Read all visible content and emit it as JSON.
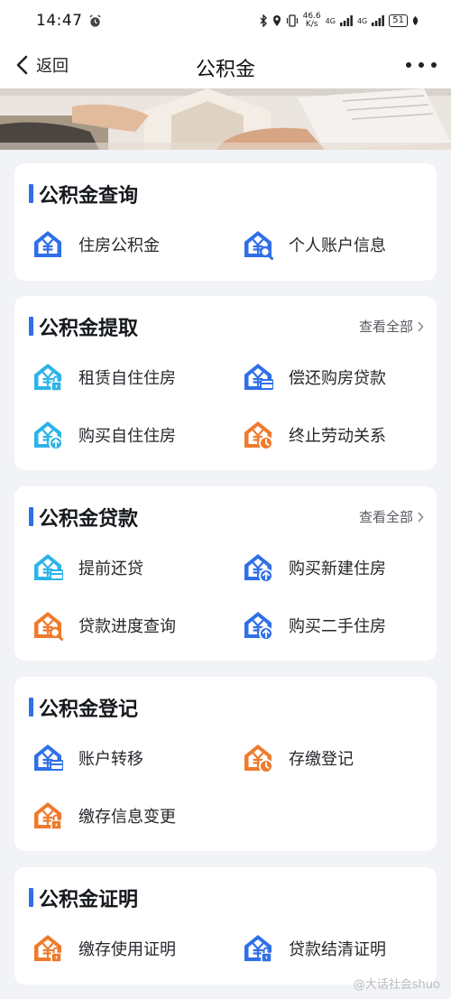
{
  "status_bar": {
    "time": "14:47",
    "speed_value": "46.6",
    "speed_unit": "K/s",
    "network_1": "4G",
    "network_2": "4G",
    "battery": "51"
  },
  "nav": {
    "back_label": "返回",
    "title": "公积金"
  },
  "sections": {
    "query": {
      "title": "公积金查询",
      "items": [
        {
          "label": "住房公积金",
          "icon": "house-yuan-icon"
        },
        {
          "label": "个人账户信息",
          "icon": "house-yuan-search-icon"
        }
      ]
    },
    "withdraw": {
      "title": "公积金提取",
      "view_all": "查看全部",
      "items": [
        {
          "label": "租赁自住住房",
          "icon": "house-yuan-lock-icon"
        },
        {
          "label": "偿还购房贷款",
          "icon": "house-yuan-card-icon"
        },
        {
          "label": "购买自住住房",
          "icon": "house-yuan-up-icon"
        },
        {
          "label": "终止劳动关系",
          "icon": "house-yuan-clock-icon"
        }
      ]
    },
    "loan": {
      "title": "公积金贷款",
      "view_all": "查看全部",
      "items": [
        {
          "label": "提前还贷",
          "icon": "house-yuan-card-icon"
        },
        {
          "label": "购买新建住房",
          "icon": "house-yuan-up-icon"
        },
        {
          "label": "贷款进度查询",
          "icon": "house-yuan-search-icon"
        },
        {
          "label": "购买二手住房",
          "icon": "house-yuan-up-icon"
        }
      ]
    },
    "register": {
      "title": "公积金登记",
      "items": [
        {
          "label": "账户转移",
          "icon": "house-yuan-card-icon"
        },
        {
          "label": "存缴登记",
          "icon": "house-yuan-clock-icon"
        },
        {
          "label": "缴存信息变更",
          "icon": "house-yuan-lock-icon"
        }
      ]
    },
    "certificate": {
      "title": "公积金证明",
      "items": [
        {
          "label": "缴存使用证明",
          "icon": "house-yuan-lock-icon"
        },
        {
          "label": "贷款结清证明",
          "icon": "house-yuan-lock-icon"
        }
      ]
    }
  },
  "watermark": "@大话社会shuo",
  "colors": {
    "accent": "#2f6fe8",
    "icon_blue": "#2f6fe8",
    "icon_cyan": "#2bb3e8",
    "icon_orange": "#f07a2c",
    "background": "#f2f3f7"
  }
}
